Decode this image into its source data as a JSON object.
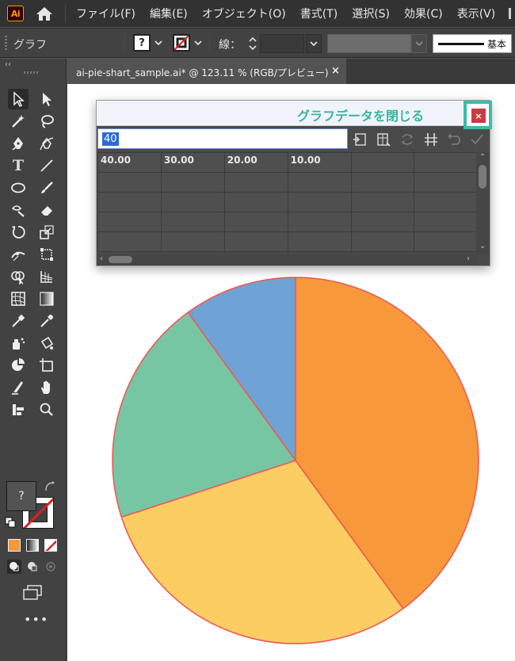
{
  "app": {
    "logo_text": "Ai",
    "menu": [
      "ファイル(F)",
      "編集(E)",
      "オブジェクト(O)",
      "書式(T)",
      "選択(S)",
      "効果(C)",
      "表示(V)"
    ]
  },
  "control_bar": {
    "label": "グラフ",
    "fill_value": "?",
    "stroke_label": "線：",
    "brush_name": "基本"
  },
  "document": {
    "tab_title": "ai-pie-shart_sample.ai* @ 123.11 % (RGB/プレビュー)",
    "close_glyph": "×"
  },
  "tools": {
    "collapse_glyph": "‹‹",
    "fill_value": "?",
    "more_label": "•••"
  },
  "graph_data_window": {
    "annotation": "グラフデータを閉じる",
    "close_glyph": "×",
    "input_value": "40",
    "rows": [
      [
        "40.00",
        "30.00",
        "20.00",
        "10.00",
        "",
        ""
      ],
      [
        "",
        "",
        "",
        "",
        "",
        ""
      ],
      [
        "",
        "",
        "",
        "",
        "",
        ""
      ],
      [
        "",
        "",
        "",
        "",
        "",
        ""
      ],
      [
        "",
        "",
        "",
        "",
        "",
        ""
      ]
    ]
  },
  "colors": {
    "slice_orange": "#f7983a",
    "slice_yellow": "#fbcd62",
    "slice_green": "#76c6a4",
    "slice_blue": "#6fa3d5",
    "slice_stroke": "#ef5a55",
    "accent_teal": "#3dbba6",
    "close_red": "#cb3a44"
  },
  "chart_data": {
    "type": "pie",
    "values": [
      40,
      30,
      20,
      10
    ],
    "colors": [
      "#f7983a",
      "#fbcd62",
      "#76c6a4",
      "#6fa3d5"
    ],
    "start": "12 o'clock",
    "direction": "clockwise"
  }
}
